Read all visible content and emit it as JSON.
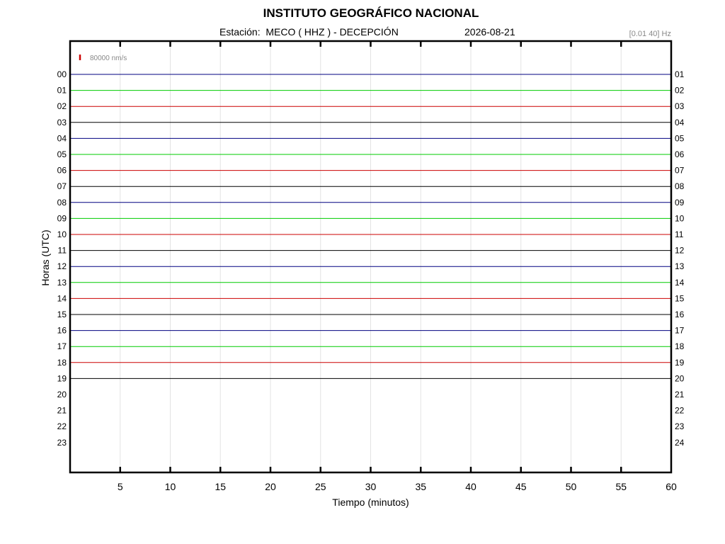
{
  "header": {
    "title": "INSTITUTO GEOGRÁFICO NACIONAL",
    "station_label": "Estación:  MECO ( HHZ ) - DECEPCIÓN",
    "date": "2026-08-21",
    "filter": "[0.01 40] Hz"
  },
  "chart_data": {
    "type": "line",
    "title": "INSTITUTO GEOGRÁFICO NACIONAL",
    "xlabel": "Tiempo (minutos)",
    "ylabel": "Horas (UTC)",
    "xlim": [
      0,
      60
    ],
    "x_ticks": [
      5,
      10,
      15,
      20,
      25,
      30,
      35,
      40,
      45,
      50,
      55,
      60
    ],
    "left_labels": [
      "00",
      "01",
      "02",
      "03",
      "04",
      "05",
      "06",
      "07",
      "08",
      "09",
      "10",
      "11",
      "12",
      "13",
      "14",
      "15",
      "16",
      "17",
      "18",
      "19",
      "20",
      "21",
      "22",
      "23"
    ],
    "right_labels": [
      "01",
      "02",
      "03",
      "04",
      "05",
      "06",
      "07",
      "08",
      "09",
      "10",
      "11",
      "12",
      "13",
      "14",
      "15",
      "16",
      "17",
      "18",
      "19",
      "20",
      "21",
      "22",
      "23",
      "24"
    ],
    "scale_label": "80000 nm/s",
    "scale_color": "#cc0000",
    "grid": "vertical",
    "trace_colors": [
      "#000080",
      "#00cc00",
      "#cc0000",
      "#000000"
    ],
    "traces_drawn": 20,
    "traces": [
      {
        "hour": "00",
        "value": 0
      },
      {
        "hour": "01",
        "value": 0
      },
      {
        "hour": "02",
        "value": 0
      },
      {
        "hour": "03",
        "value": 0
      },
      {
        "hour": "04",
        "value": 0
      },
      {
        "hour": "05",
        "value": 0
      },
      {
        "hour": "06",
        "value": 0
      },
      {
        "hour": "07",
        "value": 0
      },
      {
        "hour": "08",
        "value": 0
      },
      {
        "hour": "09",
        "value": 0
      },
      {
        "hour": "10",
        "value": 0
      },
      {
        "hour": "11",
        "value": 0
      },
      {
        "hour": "12",
        "value": 0
      },
      {
        "hour": "13",
        "value": 0
      },
      {
        "hour": "14",
        "value": 0
      },
      {
        "hour": "15",
        "value": 0
      },
      {
        "hour": "16",
        "value": 0
      },
      {
        "hour": "17",
        "value": 0
      },
      {
        "hour": "18",
        "value": 0
      },
      {
        "hour": "19",
        "value": 0
      }
    ]
  }
}
